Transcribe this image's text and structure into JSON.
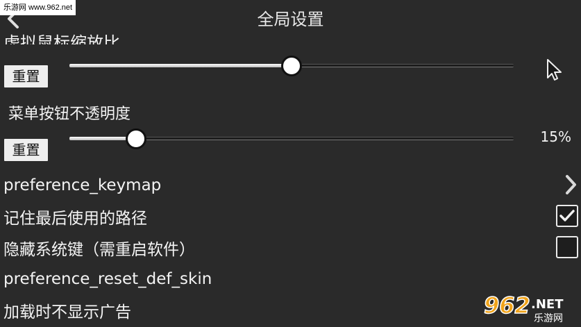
{
  "watermark": {
    "text": "乐游网 www.962.net"
  },
  "header": {
    "title": "全局设置",
    "back_icon": "chevron-left-icon"
  },
  "mouse_scale": {
    "label": "虚拟鼠标缩放比",
    "reset_label": "重置",
    "value_fraction": 0.5,
    "trail_icon": "mouse-cursor-icon"
  },
  "button_opacity": {
    "label": "菜单按钮不透明度",
    "reset_label": "重置",
    "value_fraction": 0.15,
    "value_text": "15%"
  },
  "rows": [
    {
      "label": "preference_keymap",
      "type": "nav",
      "icon": "chevron-right-icon"
    },
    {
      "label": "记住最后使用的路径",
      "type": "checkbox",
      "checked": true
    },
    {
      "label": "隐藏系统键（需重启软件）",
      "type": "checkbox",
      "checked": false
    },
    {
      "label": "preference_reset_def_skin",
      "type": "plain"
    },
    {
      "label": "加载时不显示广告",
      "type": "plain"
    }
  ],
  "logo": {
    "number": "962",
    "suffix": ".NET",
    "caption": "乐游网"
  },
  "colors": {
    "background": "#2a2a2a",
    "text": "#f4f4f4",
    "logo_orange": "#f0a31a"
  }
}
